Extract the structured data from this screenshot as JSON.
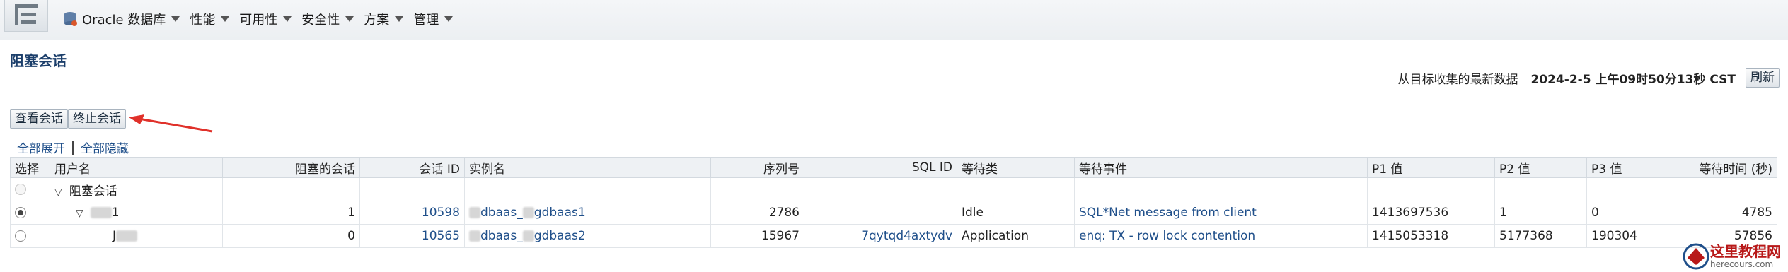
{
  "menubar": {
    "items": [
      {
        "label": "Oracle 数据库"
      },
      {
        "label": "性能"
      },
      {
        "label": "可用性"
      },
      {
        "label": "安全性"
      },
      {
        "label": "方案"
      },
      {
        "label": "管理"
      }
    ]
  },
  "page": {
    "title": "阻塞会话",
    "refresh_label": "从目标收集的最新数据",
    "timestamp": "2024-2-5 上午09时50分13秒 CST",
    "refresh_button": "刷新"
  },
  "actions": {
    "view_session": "查看会话",
    "kill_session": "终止会话",
    "expand_all": "全部展开",
    "collapse_all": "全部隐藏"
  },
  "table": {
    "headers": [
      "选择",
      "用户名",
      "阻塞的会话",
      "会话 ID",
      "实例名",
      "序列号",
      "SQL ID",
      "等待类",
      "等待事件",
      "P1 值",
      "P2 值",
      "P3 值",
      "等待时间 (秒)"
    ],
    "root_label": "阻塞会话",
    "rows": [
      {
        "user": "1",
        "blocked": "1",
        "sid": "10598",
        "instance_a": "dbaas_",
        "instance_b": "gdbaas1",
        "serial": "2786",
        "sql_id": "",
        "wait_class": "Idle",
        "wait_event": "SQL*Net message from client",
        "p1": "1413697536",
        "p2": "1",
        "p3": "0",
        "wait_time": "4785"
      },
      {
        "user": "J",
        "blocked": "0",
        "sid": "10565",
        "instance_a": "dbaas_",
        "instance_b": "gdbaas2",
        "serial": "15967",
        "sql_id": "7qytqd4axtydv",
        "wait_class": "Application",
        "wait_event": "enq: TX - row lock contention",
        "p1": "1415053318",
        "p2": "5177368",
        "p3": "190304",
        "wait_time": "57856"
      }
    ]
  },
  "watermark": {
    "title": "这里教程网",
    "url": "herecours.com"
  },
  "colors": {
    "link": "#1f4f8a",
    "title": "#1c3f6b",
    "arrow": "#e0312a"
  }
}
